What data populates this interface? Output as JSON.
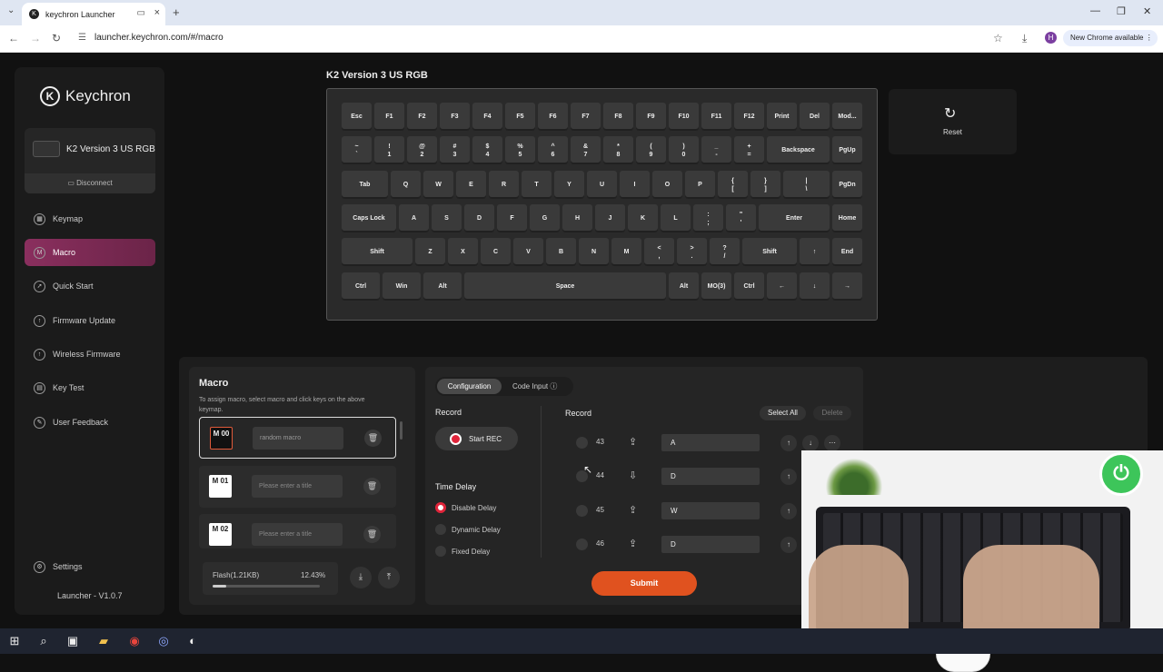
{
  "browser": {
    "tab_title": "keychron Launcher",
    "url": "launcher.keychron.com/#/macro",
    "avatar": "H",
    "new_chrome": "New Chrome available"
  },
  "app": {
    "brand": "Keychron",
    "device_name": "K2 Version 3 US RGB",
    "disconnect": "Disconnect",
    "nav": [
      {
        "label": "Keymap",
        "icon": "keyboard-icon"
      },
      {
        "label": "Macro",
        "icon": "macro-icon",
        "active": true
      },
      {
        "label": "Quick Start",
        "icon": "rocket-icon"
      },
      {
        "label": "Firmware Update",
        "icon": "upload-icon"
      },
      {
        "label": "Wireless Firmware",
        "icon": "upload-icon"
      },
      {
        "label": "Key Test",
        "icon": "key-test-icon"
      },
      {
        "label": "User Feedback",
        "icon": "feedback-icon"
      }
    ],
    "settings": "Settings",
    "version": "Launcher - V1.0.7"
  },
  "keyboard": {
    "title": "K2 Version 3 US RGB",
    "reset": "Reset",
    "rows": [
      [
        "Esc",
        "F1",
        "F2",
        "F3",
        "F4",
        "F5",
        "F6",
        "F7",
        "F8",
        "F9",
        "F10",
        "F11",
        "F12",
        "Print",
        "Del",
        "Mod..."
      ],
      [
        "~\n`",
        "!\n1",
        "@\n2",
        "#\n3",
        "$\n4",
        "%\n5",
        "^\n6",
        "&\n7",
        "*\n8",
        "(\n9",
        ")\n0",
        "_\n-",
        "+\n=",
        "Backspace",
        "PgUp"
      ],
      [
        "Tab",
        "Q",
        "W",
        "E",
        "R",
        "T",
        "Y",
        "U",
        "I",
        "O",
        "P",
        "{\n[",
        "}\n]",
        "|\n\\",
        "PgDn"
      ],
      [
        "Caps Lock",
        "A",
        "S",
        "D",
        "F",
        "G",
        "H",
        "J",
        "K",
        "L",
        ":\n;",
        "\"\n'",
        "Enter",
        "Home"
      ],
      [
        "Shift",
        "Z",
        "X",
        "C",
        "V",
        "B",
        "N",
        "M",
        "<\n,",
        ">\n.",
        "?\n/",
        "Shift",
        "↑",
        "End"
      ],
      [
        "Ctrl",
        "Win",
        "Alt",
        "Space",
        "Alt",
        "MO(3)",
        "Ctrl",
        "←",
        "↓",
        "→"
      ]
    ]
  },
  "macro": {
    "title": "Macro",
    "description": "To assign macro, select macro and click keys on the above keymap.",
    "items": [
      {
        "key": "M\n00",
        "value": "random macro",
        "selected": true
      },
      {
        "key": "M\n01",
        "placeholder": "Please enter a title"
      },
      {
        "key": "M\n02",
        "placeholder": "Please enter a title"
      }
    ],
    "flash_label": "Flash(1.21KB)",
    "flash_percent": "12.43%",
    "flash_fraction": 0.1243
  },
  "config": {
    "tab_config": "Configuration",
    "tab_code": "Code Input",
    "record_label": "Record",
    "start_rec": "Start REC",
    "time_delay": "Time Delay",
    "delay_options": [
      {
        "label": "Disable Delay",
        "selected": true
      },
      {
        "label": "Dynamic Delay",
        "selected": false
      },
      {
        "label": "Fixed Delay",
        "selected": false
      }
    ],
    "records_title": "Record",
    "select_all": "Select All",
    "delete": "Delete",
    "records": [
      {
        "num": "43",
        "action": "key-up-icon",
        "value": "A"
      },
      {
        "num": "44",
        "action": "key-down-icon",
        "value": "D"
      },
      {
        "num": "45",
        "action": "key-up-icon",
        "value": "W"
      },
      {
        "num": "46",
        "action": "key-up-icon",
        "value": "D"
      }
    ],
    "submit": "Submit"
  }
}
